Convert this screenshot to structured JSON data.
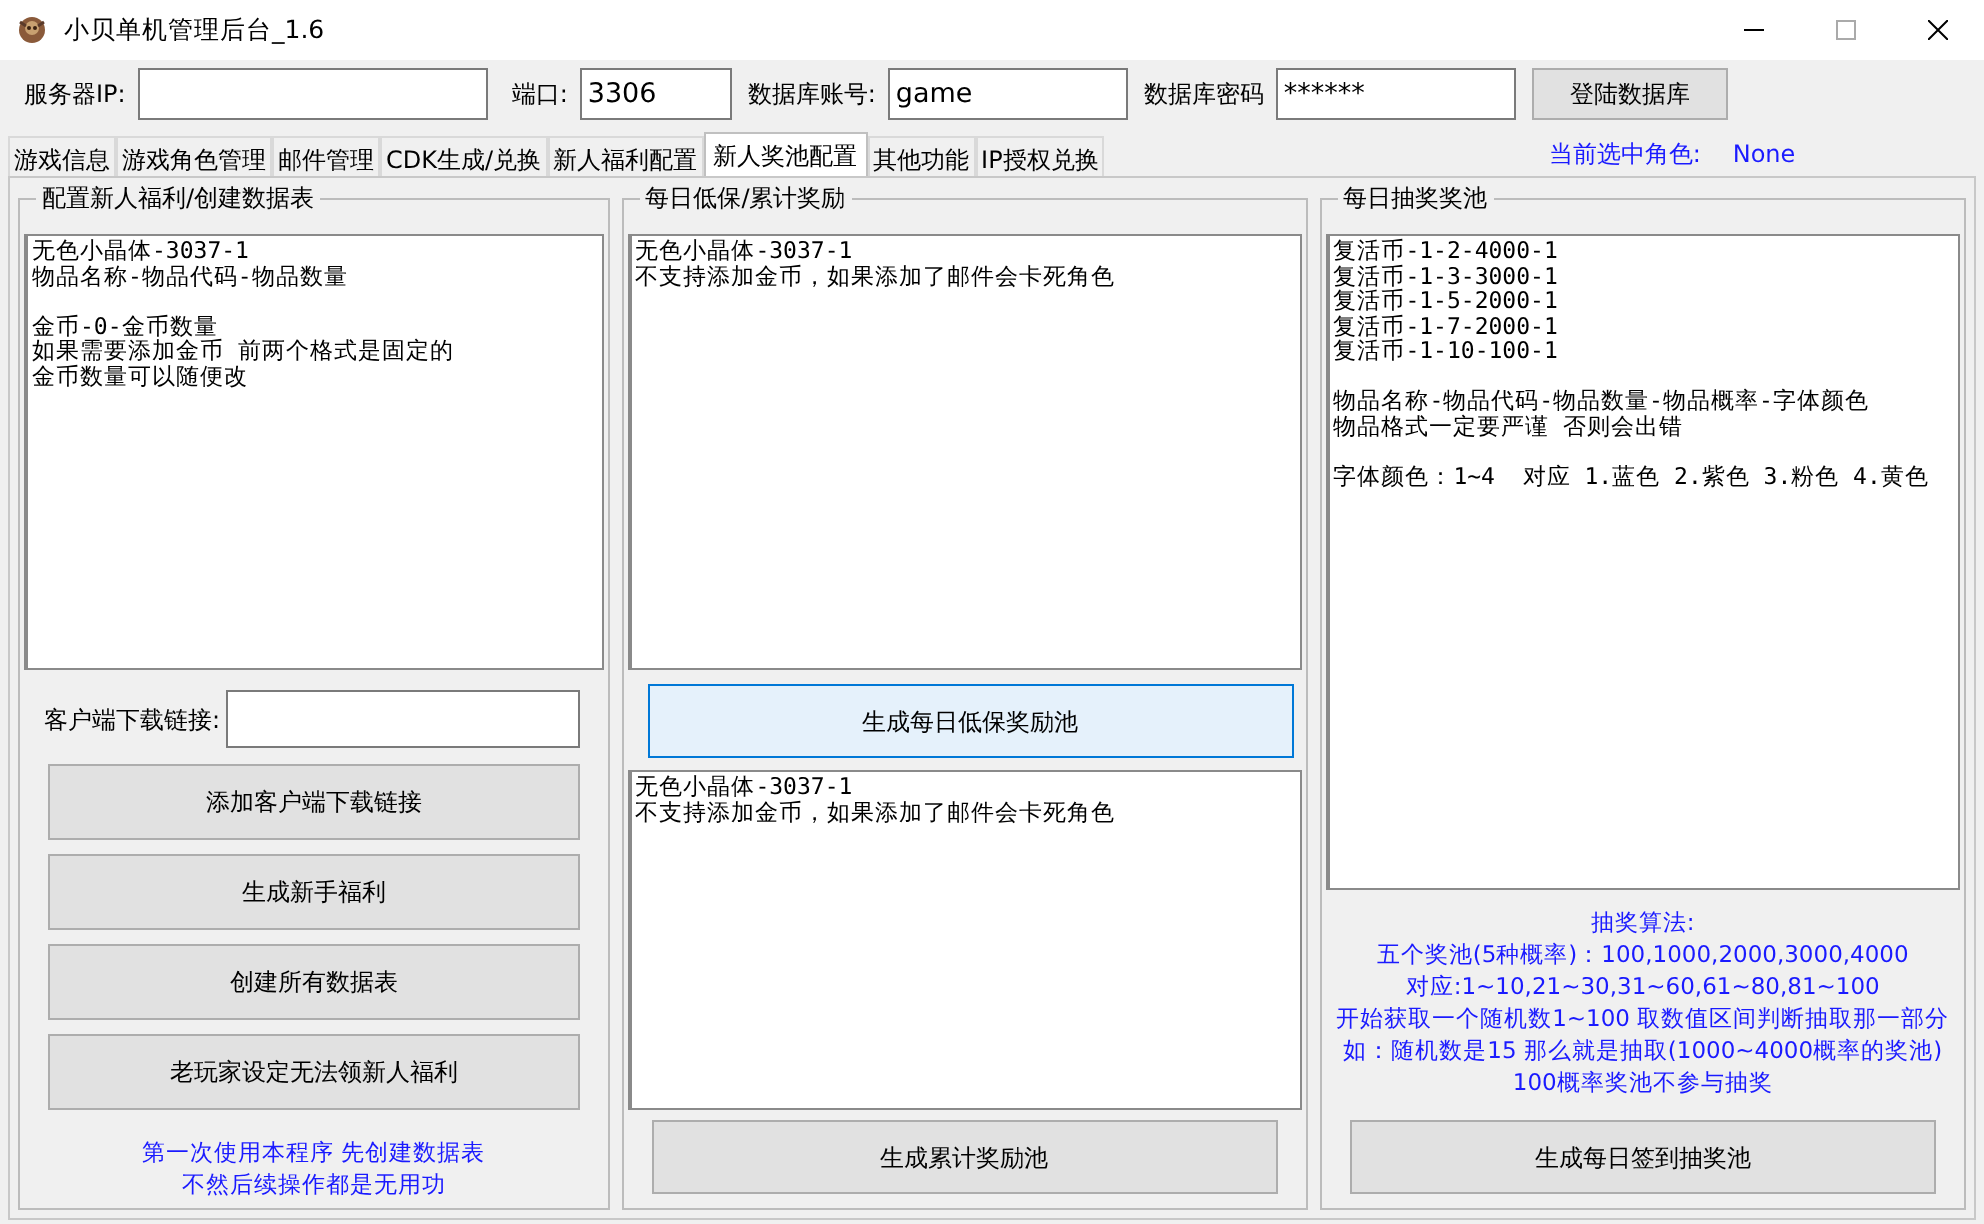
{
  "window": {
    "title": "小贝单机管理后台_1.6"
  },
  "connection": {
    "fields": [
      {
        "label": "服务器IP:"
      },
      {
        "label": "端口:",
        "value": "3306"
      },
      {
        "label": "数据库账号:",
        "value": "game"
      },
      {
        "label": "数据库密码",
        "value": "******"
      }
    ],
    "login_button": "登陆数据库"
  },
  "tabs": [
    {
      "label": "游戏信息",
      "selected": false
    },
    {
      "label": "游戏角色管理",
      "selected": false
    },
    {
      "label": "邮件管理",
      "selected": false
    },
    {
      "label": "CDK生成/兑换",
      "selected": false
    },
    {
      "label": "新人福利配置",
      "selected": false
    },
    {
      "label": "新人奖池配置",
      "selected": true
    },
    {
      "label": "其他功能",
      "selected": false
    },
    {
      "label": "IP授权兑换",
      "selected": false
    }
  ],
  "current_role": {
    "label": "当前选中角色:",
    "value": "None"
  },
  "panels": [
    {
      "title": "配置新人福利/创建数据表",
      "items": [
        {
          "kind": "textarea",
          "paragraphs": [
            [
              "无色小晶体-3037-1",
              "物品名称-物品代码-物品数量"
            ],
            [
              "金币-0-金币数量",
              "如果需要添加金币 前两个格式是固定的",
              "金币数量可以随便改"
            ]
          ]
        },
        {
          "kind": "field",
          "label": "客户端下载链接:"
        },
        {
          "kind": "button",
          "label": "添加客户端下载链接",
          "focused": false
        },
        {
          "kind": "button",
          "label": "生成新手福利",
          "focused": false
        },
        {
          "kind": "button",
          "label": "创建所有数据表",
          "focused": false
        },
        {
          "kind": "button",
          "label": "老玩家设定无法领新人福利",
          "focused": false
        },
        {
          "kind": "note",
          "lines": [
            "第一次使用本程序 先创建数据表",
            "不然后续操作都是无用功"
          ]
        }
      ]
    },
    {
      "title": "每日低保/累计奖励",
      "items": [
        {
          "kind": "textarea",
          "paragraphs": [
            [
              "无色小晶体-3037-1",
              "不支持添加金币，如果添加了邮件会卡死角色"
            ]
          ]
        },
        {
          "kind": "button",
          "label": "生成每日低保奖励池",
          "focused": true
        },
        {
          "kind": "textarea",
          "paragraphs": [
            [
              "无色小晶体-3037-1",
              "不支持添加金币，如果添加了邮件会卡死角色"
            ]
          ]
        },
        {
          "kind": "button",
          "label": "生成累计奖励池",
          "focused": false
        }
      ]
    },
    {
      "title": "每日抽奖奖池",
      "items": [
        {
          "kind": "textarea",
          "paragraphs": [
            [
              "复活币-1-2-4000-1",
              "复活币-1-3-3000-1",
              "复活币-1-5-2000-1",
              "复活币-1-7-2000-1",
              "复活币-1-10-100-1"
            ],
            [
              "物品名称-物品代码-物品数量-物品概率-字体颜色",
              "物品格式一定要严谨 否则会出错"
            ],
            [
              "字体颜色：1~4  对应 1.蓝色 2.紫色 3.粉色 4.黄色"
            ]
          ]
        },
        {
          "kind": "note",
          "lines": [
            "抽奖算法:",
            "五个奖池(5种概率)：100,1000,2000,3000,4000",
            "对应:1~10,21~30,31~60,61~80,81~100",
            "开始获取一个随机数1~100 取数值区间判断抽取那一部分",
            "如：随机数是15 那么就是抽取(1000~4000概率的奖池)",
            "100概率奖池不参与抽奖"
          ]
        },
        {
          "kind": "button",
          "label": "生成每日签到抽奖池",
          "focused": false
        }
      ]
    }
  ]
}
